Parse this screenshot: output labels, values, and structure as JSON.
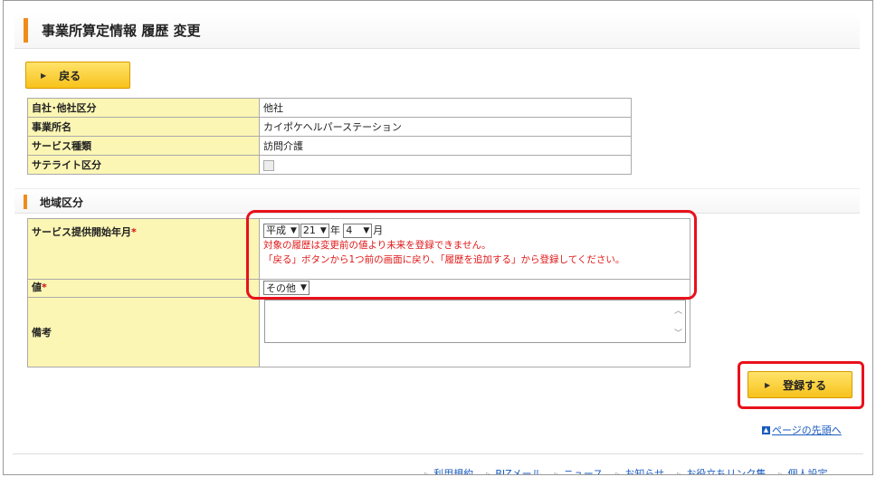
{
  "header": {
    "title": "事業所算定情報 履歴 変更"
  },
  "buttons": {
    "back": "戻る",
    "register": "登録する"
  },
  "info_rows": [
    {
      "label": "自社･他社区分",
      "value": "他社"
    },
    {
      "label": "事業所名",
      "value": "カイポケヘルパーステーション"
    },
    {
      "label": "サービス種類",
      "value": "訪問介護"
    },
    {
      "label": "サテライト区分",
      "value": ""
    }
  ],
  "section": {
    "title": "地域区分"
  },
  "form": {
    "start_label": "サービス提供開始年月",
    "required_mark": "*",
    "era": "平成",
    "year": "21",
    "year_unit": "年",
    "month": "4",
    "month_unit": "月",
    "error_line1": "対象の履歴は変更前の値より未来を登録できません。",
    "error_line2": "「戻る」ボタンから1つ前の画面に戻り、「履歴を追加する」から登録してください。",
    "value_label": "値",
    "value_selected": "その他",
    "note_label": "備考"
  },
  "page_top_link": "ページの先頭へ",
  "footer_links": [
    "利用規約",
    "BIZメール",
    "ニュース",
    "お知らせ",
    "お役立ちリンク集",
    "個人設定"
  ],
  "colors": {
    "accent": "#f08c1c",
    "label_bg": "#fbf6b4",
    "highlight": "#e8111b",
    "link": "#1a5bbf",
    "error": "#e01818"
  }
}
